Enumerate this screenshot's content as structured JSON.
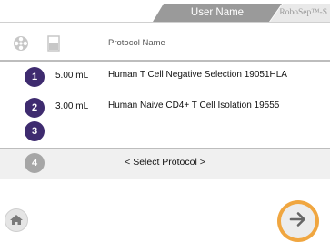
{
  "header": {
    "user_tab": "User Name",
    "brand": "RoboSep™-S"
  },
  "columns": {
    "title": "Protocol Name",
    "icons": [
      "target-icon",
      "tube-icon"
    ]
  },
  "rows": [
    {
      "number": "1",
      "volume": "5.00 mL",
      "name": "Human T Cell Negative Selection 19051HLA"
    },
    {
      "number": "2",
      "volume": "3.00 mL",
      "name": "Human Naive CD4+ T Cell Isolation 19555"
    },
    {
      "number": "3",
      "volume": "",
      "name": ""
    },
    {
      "number": "4",
      "select_label": "< Select Protocol >"
    }
  ],
  "footer": {
    "home_icon": "home-icon",
    "next_icon": "arrow-right-icon"
  },
  "colors": {
    "badge_active": "#3e2b6f",
    "badge_inactive": "#a6a6a6",
    "next_accent": "#f0a640"
  }
}
